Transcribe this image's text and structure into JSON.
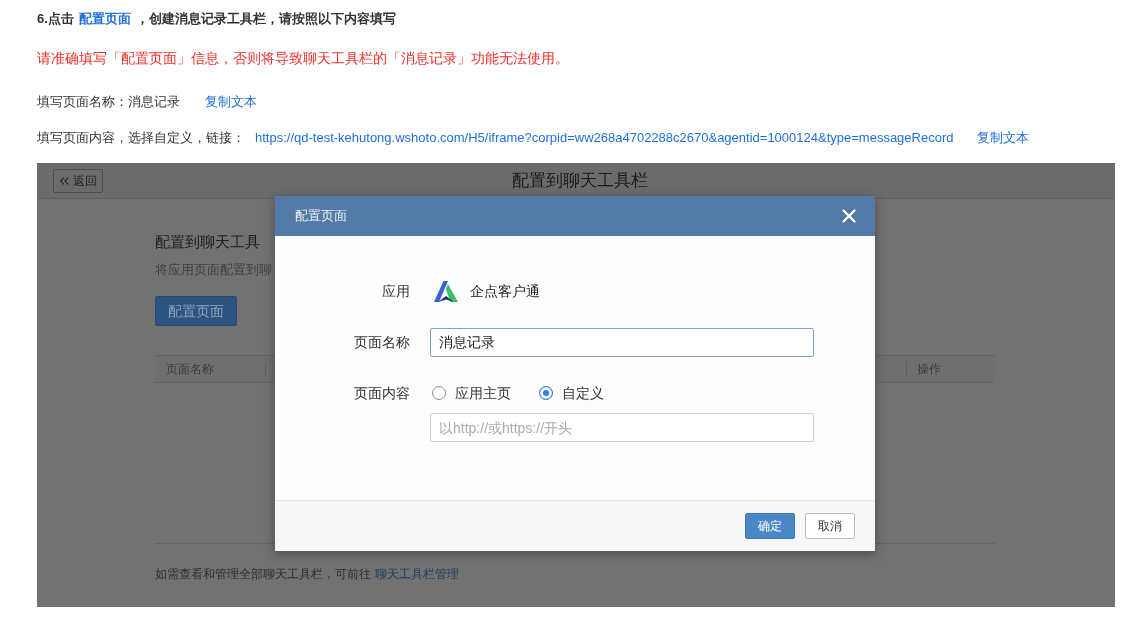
{
  "instructions": {
    "heading": {
      "before": "6.点击",
      "link": "配置页面",
      "after": "，创建消息记录工具栏，请按照以下内容填写"
    },
    "warning": "请准确填写「配置页面」信息，否则将导致聊天工具栏的「消息记录」功能无法使用。",
    "lines": [
      {
        "kind": "text",
        "text": "填写页面名称：消息记录",
        "copy": "复制文本"
      },
      {
        "kind": "link",
        "text": "填写页面内容，选择自定义，链接：",
        "url": "https://qd-test-kehutong.wshoto.com/H5/iframe?corpid=ww268a4702288c2670&agentid=1000124&type=messageRecord",
        "copy": "复制文本"
      }
    ]
  },
  "screenshot": {
    "header": {
      "back": "返回",
      "title": "配置到聊天工具栏"
    },
    "page": {
      "title": "配置到聊天工具",
      "subtitle": "将应用页面配置到聊",
      "button": "配置页面",
      "table": {
        "columns": [
          "页面名称",
          "操作"
        ]
      },
      "footer": {
        "text": "如需查看和管理全部聊天工具栏，可前往",
        "link": "聊天工具栏管理"
      }
    },
    "dialog": {
      "title": "配置页面",
      "app": {
        "label": "应用",
        "name": "企点客户通"
      },
      "page_name": {
        "label": "页面名称",
        "value": "消息记录",
        "focused": true
      },
      "page_content": {
        "label": "页面内容",
        "options": [
          {
            "label": "应用主页",
            "selected": false
          },
          {
            "label": "自定义",
            "selected": true
          }
        ],
        "url": {
          "placeholder": "以http://或https://开头"
        }
      },
      "buttons": [
        {
          "label": "确定",
          "kind": "primary"
        },
        {
          "label": "取消",
          "kind": "default"
        }
      ]
    }
  }
}
